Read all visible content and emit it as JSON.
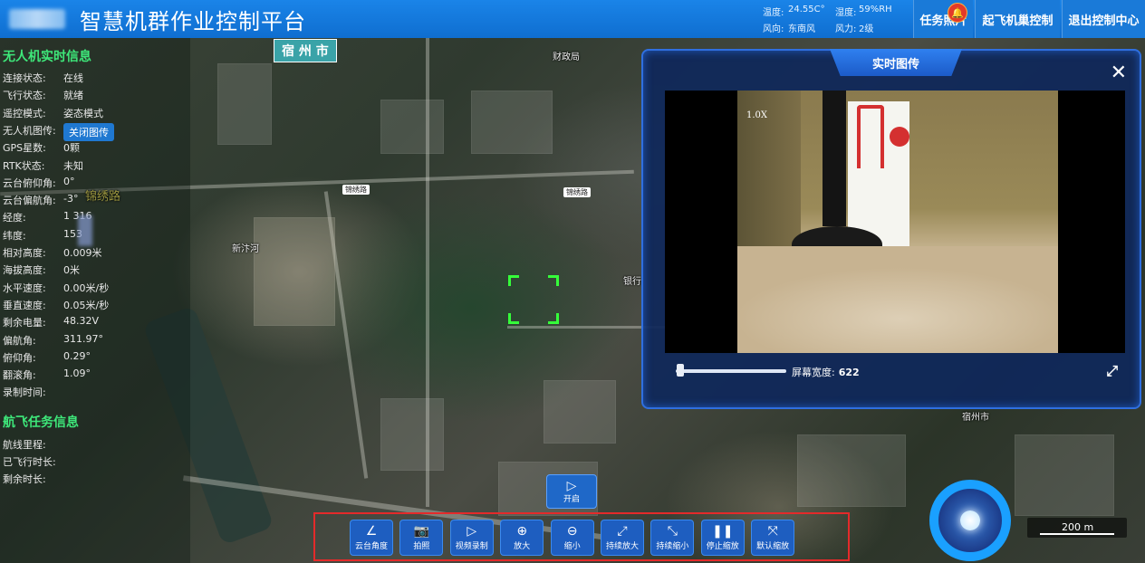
{
  "header": {
    "title": "智慧机群作业控制平台",
    "weather": {
      "temp_label": "温度:",
      "temp_value": "24.55C°",
      "humidity_label": "湿度:",
      "humidity_value": "59%RH",
      "wind_dir_label": "风向:",
      "wind_dir_value": "东南风",
      "wind_force_label": "风力:",
      "wind_force_value": "2级"
    },
    "buttons": {
      "task_photos": "任务照片",
      "takeoff_nest_control": "起飞机巢控制",
      "exit_control_center": "退出控制中心"
    },
    "badge_icon": "bell-icon"
  },
  "drone_info": {
    "title": "无人机实时信息",
    "rows": [
      {
        "label": "连接状态:",
        "value": "在线"
      },
      {
        "label": "飞行状态:",
        "value": "就绪"
      },
      {
        "label": "遥控模式:",
        "value": "姿态模式"
      },
      {
        "label": "无人机图传:",
        "value": ""
      },
      {
        "label": "GPS星数:",
        "value": "0颗"
      },
      {
        "label": "RTK状态:",
        "value": "未知"
      },
      {
        "label": "云台俯仰角:",
        "value": "0°"
      },
      {
        "label": "云台偏航角:",
        "value": "-3°"
      },
      {
        "label": "经度:",
        "value": "1 316"
      },
      {
        "label": "纬度:",
        "value": "153"
      },
      {
        "label": "相对高度:",
        "value": "0.009米"
      },
      {
        "label": "海拔高度:",
        "value": "0米"
      },
      {
        "label": "水平速度:",
        "value": "0.00米/秒"
      },
      {
        "label": "垂直速度:",
        "value": "0.05米/秒"
      },
      {
        "label": "剩余电量:",
        "value": "48.32V"
      },
      {
        "label": "偏航角:",
        "value": "311.97°"
      },
      {
        "label": "俯仰角:",
        "value": "0.29°"
      },
      {
        "label": "翻滚角:",
        "value": "1.09°"
      },
      {
        "label": "录制时间:",
        "value": ""
      }
    ],
    "close_feed_button": "关闭图传"
  },
  "flight_info": {
    "title": "航飞任务信息",
    "rows": [
      {
        "label": "航线里程:",
        "value": ""
      },
      {
        "label": "已飞行时长:",
        "value": ""
      },
      {
        "label": "剩余时长:",
        "value": ""
      }
    ]
  },
  "video": {
    "tab_label": "实时图传",
    "overlay_text": "1.0X",
    "screen_width_label": "屏幕宽度:",
    "screen_width_value": "622",
    "slider_fraction": 0.02
  },
  "controls": {
    "start": {
      "label": "开启",
      "icon": "play-icon"
    },
    "tools": [
      {
        "label": "云台角度",
        "icon": "angle-icon"
      },
      {
        "label": "拍照",
        "icon": "camera-icon"
      },
      {
        "label": "视频录制",
        "icon": "play-icon"
      },
      {
        "label": "放大",
        "icon": "zoom-in-icon"
      },
      {
        "label": "缩小",
        "icon": "zoom-out-icon"
      },
      {
        "label": "持续放大",
        "icon": "expand-icon"
      },
      {
        "label": "持续缩小",
        "icon": "shrink-icon"
      },
      {
        "label": "停止缩放",
        "icon": "pause-icon"
      },
      {
        "label": "默认缩放",
        "icon": "reset-zoom-icon"
      }
    ]
  },
  "map": {
    "city_tag": "宿 州 市",
    "scale_label": "200 m",
    "labels": [
      "锦绣路",
      "锦绣路",
      "锦绣路",
      "新汴河",
      "财政局",
      "宿州市",
      "银行"
    ]
  },
  "colors": {
    "header_bg": "#1a84e8",
    "accent_green": "#3ee87a",
    "toolbar_border": "#e42a2a",
    "panel_border": "#2f6fe0"
  }
}
